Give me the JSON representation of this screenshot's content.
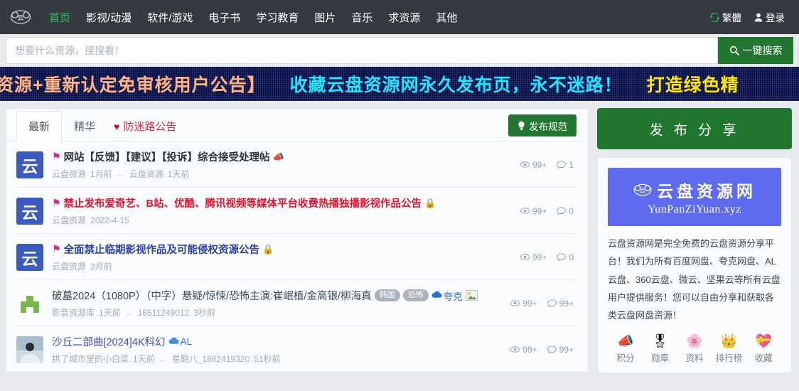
{
  "navbar": {
    "brand_icon": "cloud-logo-icon",
    "links": [
      {
        "label": "首页",
        "active": true
      },
      {
        "label": "影视/动漫",
        "active": false
      },
      {
        "label": "软件/游戏",
        "active": false
      },
      {
        "label": "电子书",
        "active": false
      },
      {
        "label": "学习教育",
        "active": false
      },
      {
        "label": "图片",
        "active": false
      },
      {
        "label": "音乐",
        "active": false
      },
      {
        "label": "求资源",
        "active": false
      },
      {
        "label": "其他",
        "active": false
      }
    ],
    "lang_toggle": "繁體",
    "login": "登录",
    "accent_green": "#2bc45a",
    "background": "#343a40"
  },
  "search": {
    "placeholder": "想要什么资源，搜搜看！",
    "value": "",
    "button_label": "一键搜索",
    "button_color": "#21772f"
  },
  "marquee": {
    "part_a": "资源+重新认定免审核用户公告】",
    "part_b": "收藏云盘资源网永久发布页，永不迷路！",
    "part_c": "打造绿色精",
    "color_a": "#ffb380",
    "color_b": "#21e6ff",
    "color_c": "#ffe600"
  },
  "tabs": [
    {
      "label": "最新",
      "active": true,
      "style": "normal"
    },
    {
      "label": "精华",
      "active": false,
      "style": "normal"
    },
    {
      "label": "防迷路公告",
      "active": false,
      "style": "alert"
    }
  ],
  "rules_button": {
    "label": "发布规范",
    "icon": "lightbulb-icon"
  },
  "posts": [
    {
      "avatar": "cloud-blue-avatar",
      "avatar_text": "云",
      "flag": true,
      "title": "网站【反馈】【建议】【投诉】综合接受处理帖",
      "title_style": "dark",
      "trailing_icon": "megaphone-icon",
      "lock": false,
      "badges": [],
      "cloud_tag": "",
      "thumb": false,
      "author": "云盘资源",
      "author_time": "1月前",
      "last_user": "云盘资源",
      "last_time": "1天前",
      "views": "99+",
      "comments": "1"
    },
    {
      "avatar": "cloud-blue-avatar",
      "avatar_text": "云",
      "flag": true,
      "title": "禁止发布爱奇艺、B站、优酷、腾讯视频等媒体平台收费热播独播影视作品公告",
      "title_style": "red",
      "trailing_icon": "",
      "lock": true,
      "badges": [],
      "cloud_tag": "",
      "thumb": false,
      "author": "云盘资源",
      "author_time": "2022-4-15",
      "last_user": "",
      "last_time": "",
      "views": "99+",
      "comments": "0"
    },
    {
      "avatar": "cloud-blue-avatar",
      "avatar_text": "云",
      "flag": true,
      "title": "全面禁止临期影视作品及可能侵权资源公告",
      "title_style": "blue",
      "trailing_icon": "",
      "lock": true,
      "badges": [],
      "cloud_tag": "",
      "thumb": false,
      "author": "云盘资源",
      "author_time": "2月前",
      "last_user": "",
      "last_time": "",
      "views": "99+",
      "comments": "0"
    },
    {
      "avatar": "green-house-avatar",
      "avatar_text": "",
      "flag": false,
      "title": "破墓2024（1080P）（中字）悬疑/惊悚/恐怖主演:崔岷植/金高银/柳海真",
      "title_style": "plain",
      "trailing_icon": "",
      "lock": false,
      "badges": [
        "韩国",
        "恐怖"
      ],
      "cloud_tag": "夸克",
      "thumb": true,
      "author": "影音资源库",
      "author_time": "1天前",
      "last_user": "18511249012",
      "last_time": "3秒前",
      "views": "99+",
      "comments": "99+"
    },
    {
      "avatar": "photo-avatar",
      "avatar_text": "",
      "flag": false,
      "title": "沙丘二部曲[2024]4K科幻",
      "title_style": "link",
      "trailing_icon": "",
      "lock": false,
      "badges": [],
      "cloud_tag": "AL",
      "thumb": false,
      "author": "拱了城市里的小白菜",
      "author_time": "1天前",
      "last_user": "星期八_1682419320",
      "last_time": "51秒前",
      "views": "99+",
      "comments": "99+"
    }
  ],
  "sidebar": {
    "share_button": "发 布 分 享",
    "logo_cn": "云盘资源网",
    "logo_en": "YunPanZiYuan.xyz",
    "logo_bg": "#5c6bf0",
    "description": "云盘资源网是完全免费的云盘资源分享平台！我们为所有百度网盘、夸克网盘、AL云盘、360云盘、微云、坚果云等所有云盘用户提供服务！您可以自由分享和获取各类云盘网盘资源！",
    "quick_links": [
      {
        "glyph": "📣",
        "label": "积分",
        "icon": "paper-plane-icon"
      },
      {
        "glyph": "🎖",
        "label": "勋章",
        "icon": "medal-icon"
      },
      {
        "glyph": "🌸",
        "label": "资料",
        "icon": "flower-icon"
      },
      {
        "glyph": "👑",
        "label": "排行榜",
        "icon": "crown-icon"
      },
      {
        "glyph": "💝",
        "label": "收藏",
        "icon": "hearts-icon"
      }
    ]
  }
}
